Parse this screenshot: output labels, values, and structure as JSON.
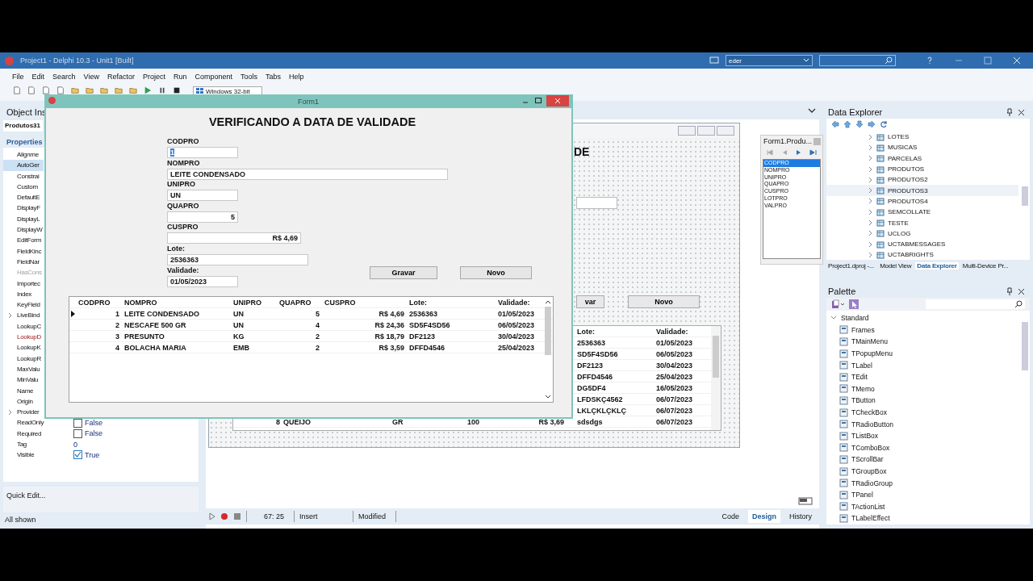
{
  "window": {
    "title": "Project1 - Delphi 10.3 - Unit1 [Built]",
    "layout": "eder"
  },
  "menu": [
    "File",
    "Edit",
    "Search",
    "View",
    "Refactor",
    "Project",
    "Run",
    "Component",
    "Tools",
    "Tabs",
    "Help"
  ],
  "toolbar": {
    "platform": "Windows 32-bit"
  },
  "object_inspector": {
    "title": "Object Ins",
    "object": "Produtos31",
    "tab": "Properties",
    "properties": [
      {
        "name": "Alignme",
        "kind": "plain",
        "expandable": false,
        "selected": false
      },
      {
        "name": "AutoGer",
        "kind": "plain",
        "expandable": false,
        "selected": true
      },
      {
        "name": "Constrai",
        "kind": "plain",
        "expandable": false,
        "selected": false
      },
      {
        "name": "Custom",
        "kind": "plain",
        "expandable": false,
        "selected": false
      },
      {
        "name": "DefaultE",
        "kind": "plain",
        "expandable": false,
        "selected": false
      },
      {
        "name": "DisplayF",
        "kind": "plain",
        "expandable": false,
        "selected": false
      },
      {
        "name": "DisplayL",
        "kind": "plain",
        "expandable": false,
        "selected": false
      },
      {
        "name": "DisplayW",
        "kind": "plain",
        "expandable": false,
        "selected": false
      },
      {
        "name": "EditForm",
        "kind": "plain",
        "expandable": false,
        "selected": false
      },
      {
        "name": "FieldKinc",
        "kind": "plain",
        "expandable": false,
        "selected": false
      },
      {
        "name": "FieldNar",
        "kind": "plain",
        "expandable": false,
        "selected": false
      },
      {
        "name": "HasCons",
        "kind": "greyed",
        "expandable": false,
        "selected": false
      },
      {
        "name": "Importec",
        "kind": "plain",
        "expandable": false,
        "selected": false
      },
      {
        "name": "Index",
        "kind": "plain",
        "expandable": false,
        "selected": false
      },
      {
        "name": "KeyField",
        "kind": "plain",
        "expandable": false,
        "selected": false
      },
      {
        "name": "LiveBind",
        "kind": "plain",
        "expandable": true,
        "selected": false
      },
      {
        "name": "LookupC",
        "kind": "plain",
        "expandable": false,
        "selected": false
      },
      {
        "name": "LookupD",
        "kind": "link",
        "expandable": false,
        "selected": false
      },
      {
        "name": "LookupK",
        "kind": "plain",
        "expandable": false,
        "selected": false
      },
      {
        "name": "LookupR",
        "kind": "plain",
        "expandable": false,
        "selected": false
      },
      {
        "name": "MaxValu",
        "kind": "plain",
        "expandable": false,
        "selected": false
      },
      {
        "name": "MinValu",
        "kind": "plain",
        "expandable": false,
        "selected": false
      },
      {
        "name": "Name",
        "kind": "plain",
        "expandable": false,
        "selected": false
      },
      {
        "name": "Origin",
        "kind": "plain",
        "expandable": false,
        "selected": false
      },
      {
        "name": "Provider",
        "kind": "plain",
        "expandable": true,
        "selected": false
      },
      {
        "name": "ReadOnly",
        "kind": "plain",
        "expandable": false,
        "selected": false,
        "value": "False",
        "checked": false
      },
      {
        "name": "Required",
        "kind": "plain",
        "expandable": false,
        "selected": false,
        "value": "False",
        "checked": false
      },
      {
        "name": "Tag",
        "kind": "plain",
        "expandable": false,
        "selected": false,
        "value": "0"
      },
      {
        "name": "Visible",
        "kind": "plain",
        "expandable": false,
        "selected": false,
        "value": "True",
        "checked": true
      }
    ],
    "quick_edit": "Quick Edit...",
    "filter": "All shown"
  },
  "designer": {
    "heading": "DE",
    "button_1": "var",
    "button_2": "Novo",
    "grid": {
      "columns": [
        "Lote:",
        "Validade:"
      ],
      "rows": [
        {
          "lote": "2536363",
          "validade": "01/05/2023"
        },
        {
          "lote": "SD5F4SD56",
          "validade": "06/05/2023"
        },
        {
          "lote": "DF2123",
          "validade": "30/04/2023"
        },
        {
          "lote": "DFFD4546",
          "validade": "25/04/2023"
        },
        {
          "lote": "DG5DF4",
          "validade": "16/05/2023"
        },
        {
          "lote": "LFDSKÇ4562",
          "validade": "06/07/2023"
        },
        {
          "lote": "LKLÇKLÇKLÇ",
          "validade": "06/07/2023"
        },
        {
          "codpro": "8",
          "nompro": "QUEIJO",
          "unipro": "GR",
          "quapro": "100",
          "cuspro": "R$ 3,69",
          "lote": "sdsdgs",
          "validade": "06/07/2023"
        }
      ]
    }
  },
  "dataset_window": {
    "title": "Form1.Produ...",
    "fields": [
      {
        "name": "CODPRO",
        "selected": true
      },
      {
        "name": "NOMPRO",
        "selected": false
      },
      {
        "name": "UNIPRO",
        "selected": false
      },
      {
        "name": "QUAPRO",
        "selected": false
      },
      {
        "name": "CUSPRO",
        "selected": false
      },
      {
        "name": "LOTPRO",
        "selected": false
      },
      {
        "name": "VALPRO",
        "selected": false
      }
    ]
  },
  "status_bar": {
    "position": "67: 25",
    "mode": "Insert",
    "state": "Modified",
    "views": [
      {
        "label": "Code",
        "selected": false
      },
      {
        "label": "Design",
        "selected": true
      },
      {
        "label": "History",
        "selected": false
      }
    ]
  },
  "data_explorer": {
    "title": "Data Explorer",
    "items": [
      {
        "label": "LOTES",
        "expanded": false,
        "selected": false
      },
      {
        "label": "MUSICAS",
        "expanded": false,
        "selected": false
      },
      {
        "label": "PARCELAS",
        "expanded": false,
        "selected": false
      },
      {
        "label": "PRODUTOS",
        "expanded": false,
        "selected": false
      },
      {
        "label": "PRODUTOS2",
        "expanded": false,
        "selected": false
      },
      {
        "label": "PRODUTOS3",
        "expanded": false,
        "selected": true
      },
      {
        "label": "PRODUTOS4",
        "expanded": false,
        "selected": false
      },
      {
        "label": "SEMCOLLATE",
        "expanded": false,
        "selected": false
      },
      {
        "label": "TESTE",
        "expanded": false,
        "selected": false
      },
      {
        "label": "UCLOG",
        "expanded": false,
        "selected": false
      },
      {
        "label": "UCTABMESSAGES",
        "expanded": false,
        "selected": false
      },
      {
        "label": "UCTABRIGHTS",
        "expanded": false,
        "selected": false
      }
    ],
    "tabs": [
      {
        "label": "Project1.dproj -...",
        "selected": false
      },
      {
        "label": "Model View",
        "selected": false
      },
      {
        "label": "Data Explorer",
        "selected": true
      },
      {
        "label": "Multi-Device Pr...",
        "selected": false
      }
    ]
  },
  "palette": {
    "title": "Palette",
    "group": {
      "label": "Standard",
      "expanded": true,
      "children": [
        "Frames",
        "TMainMenu",
        "TPopupMenu",
        "TLabel",
        "TEdit",
        "TMemo",
        "TButton",
        "TCheckBox",
        "TRadioButton",
        "TListBox",
        "TComboBox",
        "TScrollBar",
        "TGroupBox",
        "TRadioGroup",
        "TPanel",
        "TActionList",
        "TLabelEffect"
      ]
    }
  },
  "form1": {
    "title": "Form1",
    "heading": "VERIFICANDO A DATA DE VALIDADE",
    "fields": [
      {
        "label": "CODPRO",
        "value": "1",
        "focused": true
      },
      {
        "label": "NOMPRO",
        "value": "LEITE CONDENSADO",
        "focused": false
      },
      {
        "label": "UNIPRO",
        "value": "UN",
        "focused": false
      },
      {
        "label": "QUAPRO",
        "value": "5",
        "focused": false
      },
      {
        "label": "CUSPRO",
        "value": "R$ 4,69",
        "focused": false
      },
      {
        "label": "Lote:",
        "value": "2536363",
        "focused": false
      },
      {
        "label": "Validade:",
        "value": "01/05/2023",
        "focused": false
      }
    ],
    "buttons": [
      "Gravar",
      "Novo"
    ],
    "grid": {
      "columns": [
        "CODPRO",
        "NOMPRO",
        "UNIPRO",
        "QUAPRO",
        "CUSPRO",
        "Lote:",
        "Validade:"
      ],
      "rows": [
        {
          "cells": [
            "1",
            "LEITE CONDENSADO",
            "UN",
            "5",
            "R$ 4,69",
            "2536363",
            "01/05/2023"
          ],
          "selected": true
        },
        {
          "cells": [
            "2",
            "NESCAFE 500 GR",
            "UN",
            "4",
            "R$ 24,36",
            "SD5F4SD56",
            "06/05/2023"
          ],
          "selected": false
        },
        {
          "cells": [
            "3",
            "PRESUNTO",
            "KG",
            "2",
            "R$ 18,79",
            "DF2123",
            "30/04/2023"
          ],
          "selected": false
        },
        {
          "cells": [
            "4",
            "BOLACHA MARIA",
            "EMB",
            "2",
            "R$ 3,59",
            "DFFD4546",
            "25/04/2023"
          ],
          "selected": false
        }
      ]
    }
  }
}
